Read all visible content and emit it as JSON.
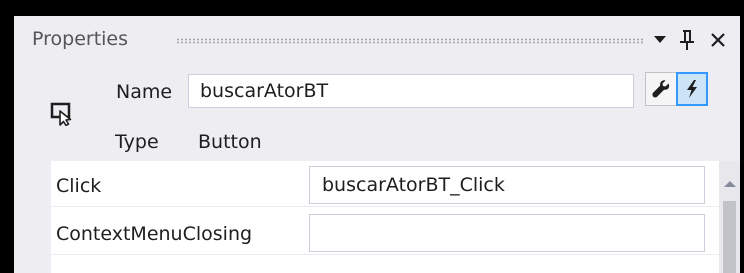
{
  "panel": {
    "title": "Properties"
  },
  "header": {
    "name_label": "Name",
    "name_value": "buscarAtorBT",
    "type_label": "Type",
    "type_value": "Button"
  },
  "events": [
    {
      "label": "Click",
      "value": "buscarAtorBT_Click"
    },
    {
      "label": "ContextMenuClosing",
      "value": ""
    }
  ],
  "icons": {
    "dropdown": "chevron-down-icon",
    "pin": "pin-icon",
    "close": "close-icon",
    "object": "object-selector-icon",
    "properties": "wrench-icon",
    "events": "lightning-bolt-icon",
    "scroll_up": "arrow-up-icon"
  },
  "colors": {
    "panel_bg": "#eeeef2",
    "active_view_border": "#3399ff",
    "active_view_bg": "#cce4f7"
  }
}
